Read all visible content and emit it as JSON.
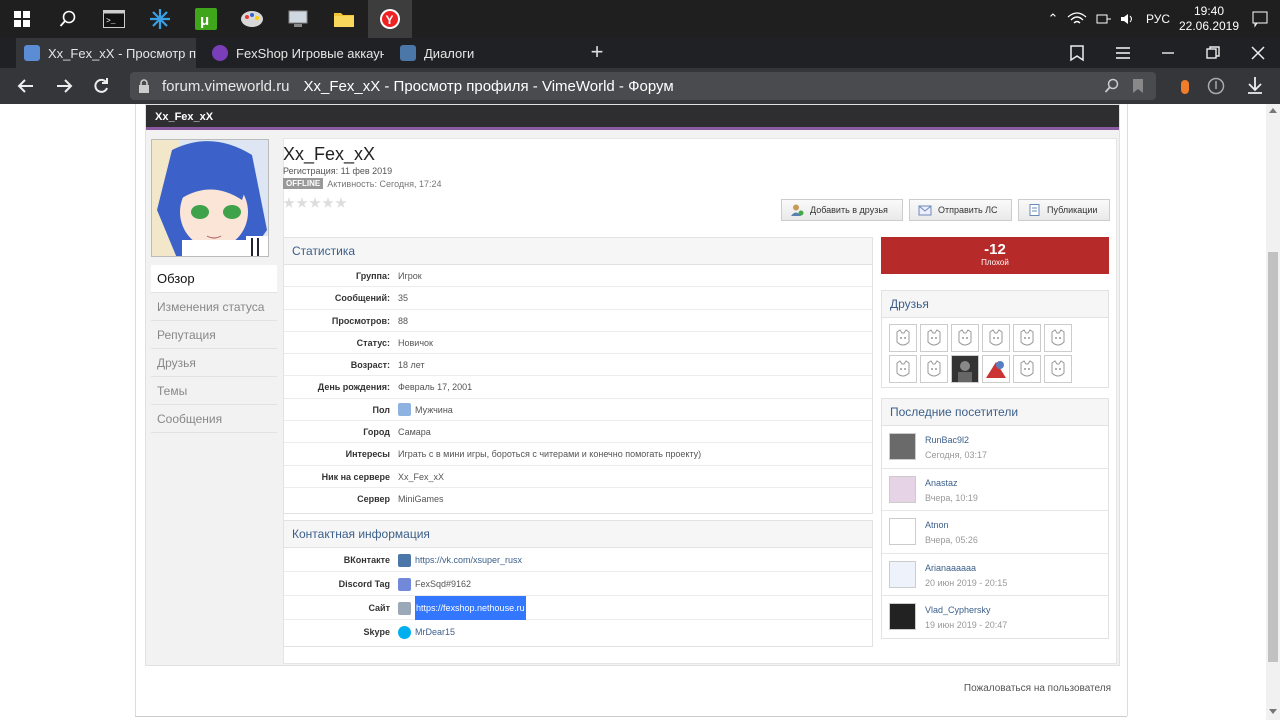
{
  "taskbar": {
    "lang": "РУС",
    "time": "19:40",
    "date": "22.06.2019"
  },
  "tabs": [
    {
      "label": "Xx_Fex_xX - Просмотр п",
      "active": true,
      "favicon_color": "#5a8dd6"
    },
    {
      "label": "FexShop Игровые аккаунт",
      "active": false,
      "favicon_color": "#7a3fb8"
    },
    {
      "label": "Диалоги",
      "active": false,
      "favicon_color": "#4a76a8"
    }
  ],
  "address": {
    "domain": "forum.vimeworld.ru",
    "title": "Xx_Fex_xX - Просмотр профиля - VimeWorld - Форум"
  },
  "header": {
    "name": "Xx_Fex_xX"
  },
  "profile": {
    "name": "Xx_Fex_xX",
    "registration": "Регистрация: 11 фев 2019",
    "offline_badge": "OFFLINE",
    "activity": "Активность: Сегодня, 17:24",
    "rating_stars": 0
  },
  "actions": {
    "add_friend": "Добавить в друзья",
    "send_pm": "Отправить ЛС",
    "publications": "Публикации"
  },
  "sidenav": [
    {
      "label": "Обзор",
      "active": true
    },
    {
      "label": "Изменения статуса",
      "active": false
    },
    {
      "label": "Репутация",
      "active": false
    },
    {
      "label": "Друзья",
      "active": false
    },
    {
      "label": "Темы",
      "active": false
    },
    {
      "label": "Сообщения",
      "active": false
    }
  ],
  "stats": {
    "title": "Статистика",
    "rows": [
      {
        "label": "Группа:",
        "value": "Игрок"
      },
      {
        "label": "Сообщений:",
        "value": "35"
      },
      {
        "label": "Просмотров:",
        "value": "88"
      },
      {
        "label": "Статус:",
        "value": "Новичок"
      },
      {
        "label": "Возраст:",
        "value": "18 лет"
      },
      {
        "label": "День рождения:",
        "value": "Февраль 17, 2001"
      },
      {
        "label": "Пол",
        "value": "Мужчина"
      },
      {
        "label": "Город",
        "value": "Самара"
      },
      {
        "label": "Интересы",
        "value": "Играть с в мини игры, бороться с читерами и конечно помогать проекту)"
      },
      {
        "label": "Ник на сервере",
        "value": "Xx_Fex_xX"
      },
      {
        "label": "Сервер",
        "value": "MiniGames"
      }
    ]
  },
  "contacts": {
    "title": "Контактная информация",
    "rows": [
      {
        "label": "ВКонтакте",
        "value": "https://vk.com/xsuper_rusx",
        "icon": "vk-icon",
        "color": "#4a76a8"
      },
      {
        "label": "Discord Tag",
        "value": "FexSqd#9162",
        "icon": "discord-icon",
        "color": "#7289da"
      },
      {
        "label": "Сайт",
        "value": "https://fexshop.nethouse.ru",
        "icon": "website-icon",
        "color": "#9aa8b8"
      },
      {
        "label": "Skype",
        "value": "MrDear15",
        "icon": "skype-icon",
        "color": "#00aff0"
      }
    ]
  },
  "reputation": {
    "value": "-12",
    "label": "Плохой",
    "color": "#b72a2a"
  },
  "friends": {
    "title": "Друзья",
    "count_slots": 12
  },
  "visitors": {
    "title": "Последние посетители",
    "items": [
      {
        "name": "RunBac9l2",
        "time": "Сегодня, 03:17"
      },
      {
        "name": "Anastaz",
        "time": "Вчера, 10:19"
      },
      {
        "name": "Atnon",
        "time": "Вчера, 05:26"
      },
      {
        "name": "Arianaaaaaa",
        "time": "20 июн 2019 - 20:15"
      },
      {
        "name": "Vlad_Cyphersky",
        "time": "19 июн 2019 - 20:47"
      }
    ]
  },
  "report_link": "Пожаловаться на пользователя"
}
